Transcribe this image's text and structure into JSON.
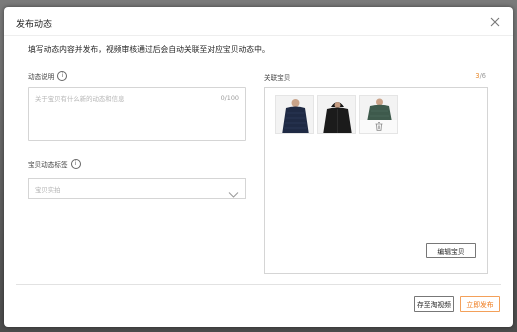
{
  "dialog": {
    "title": "发布动态",
    "notice": "填写动态内容并发布，视频审核通过后会自动关联至对应宝贝动态中。"
  },
  "form": {
    "description_label": "动态说明",
    "description_placeholder": "关于宝贝有什么新的动态和信息",
    "description_count": "0/100",
    "tag_label": "宝贝动态标签",
    "tag_placeholder": "宝贝实拍"
  },
  "products": {
    "label": "关联宝贝",
    "count_current": "3",
    "count_total": "/6",
    "edit_label": "编辑宝贝",
    "items": [
      {
        "name": "navy-quilted-jacket",
        "color": "#1f2a44"
      },
      {
        "name": "black-hooded-jacket",
        "color": "#1b1b1b"
      },
      {
        "name": "green-quilted-jacket",
        "color": "#3e5a4c"
      }
    ]
  },
  "footer": {
    "save_label": "存至淘视频",
    "publish_label": "立即发布"
  },
  "icons": {
    "close": "close-icon",
    "info": "info-icon",
    "chevron": "chevron-down-icon",
    "trash": "trash-icon"
  },
  "colors": {
    "accent": "#ef7a1a",
    "border": "#d5d5d5"
  }
}
